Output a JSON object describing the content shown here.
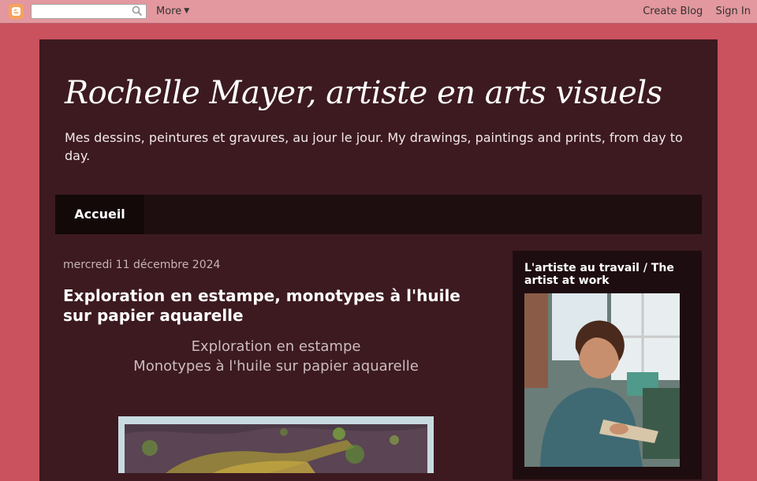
{
  "navbar": {
    "logo_icon": "blogger-logo-icon",
    "search_placeholder": "",
    "more_label": "More",
    "create_blog_label": "Create Blog",
    "sign_in_label": "Sign In"
  },
  "header": {
    "title": "Rochelle Mayer, artiste en arts visuels",
    "description": "Mes dessins, peintures et gravures, au jour le jour. My drawings, paintings and prints, from day to day."
  },
  "tabs": [
    {
      "label": "Accueil",
      "active": true
    }
  ],
  "post": {
    "date": "mercredi 11 décembre 2024",
    "title": "Exploration en estampe, monotypes à l'huile sur papier aquarelle",
    "body_line1": "Exploration en estampe",
    "body_line2": "Monotypes à l'huile sur papier aquarelle"
  },
  "sidebar": {
    "widget_title": "L'artiste au travail / The artist at work"
  },
  "colors": {
    "page_background": "#c9525e",
    "content_background": "#3c1a20",
    "tabs_background": "#1f0e10",
    "navbar_background": "#e3979e"
  }
}
